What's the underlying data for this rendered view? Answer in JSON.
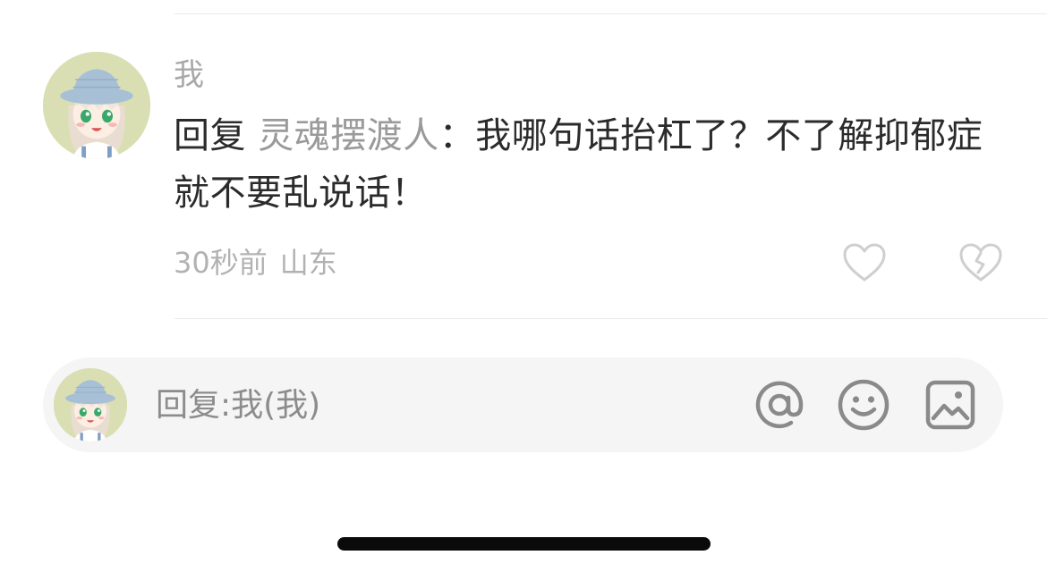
{
  "comment": {
    "username": "我",
    "reply_prefix": "回复 ",
    "reply_target": "灵魂摆渡人",
    "reply_separator": "：",
    "text": "我哪句话抬杠了？不了解抑郁症就不要乱说话！",
    "time": "30秒前",
    "location": "山东",
    "avatar_icon": "anime-girl-bucket-hat-avatar",
    "like_icon": "heart-outline-icon",
    "dislike_icon": "broken-heart-icon"
  },
  "reply_bar": {
    "placeholder": "回复:我(我)",
    "avatar_icon": "anime-girl-bucket-hat-avatar",
    "mention_icon": "at-icon",
    "emoji_icon": "smiley-icon",
    "image_icon": "image-icon"
  },
  "colors": {
    "primary_text": "#2b2b2b",
    "secondary_text": "#a8a8a8",
    "input_background": "#f5f5f5",
    "icon_gray": "#8a8a8a",
    "avatar_background": "#d9dfb3"
  }
}
